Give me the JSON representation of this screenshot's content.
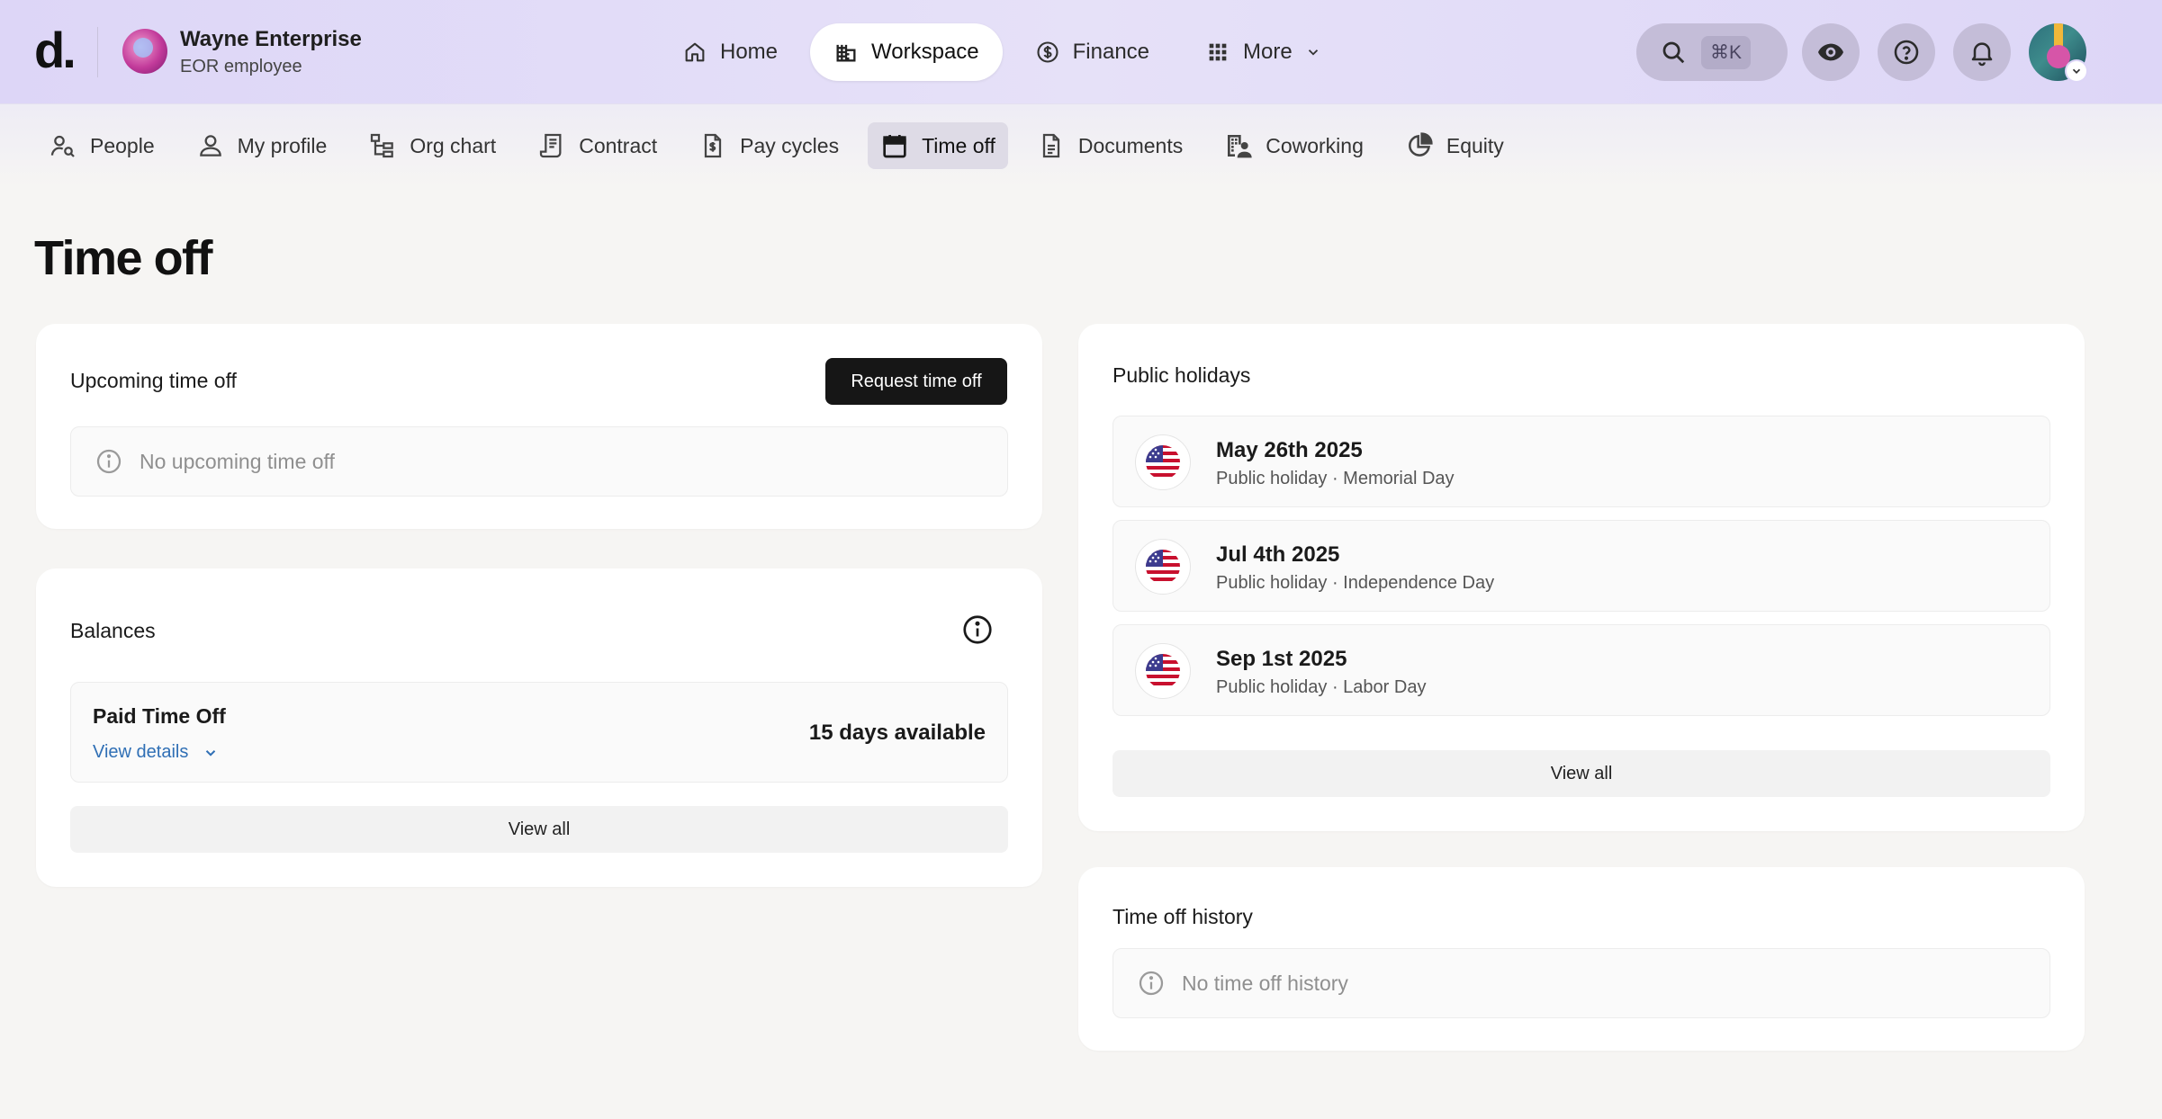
{
  "brand": {
    "logo": "d."
  },
  "org": {
    "name": "Wayne Enterprise",
    "role": "EOR employee"
  },
  "main_nav": [
    {
      "label": "Home",
      "icon": "home-icon"
    },
    {
      "label": "Workspace",
      "icon": "building-icon",
      "active": true
    },
    {
      "label": "Finance",
      "icon": "dollar-circle-icon"
    },
    {
      "label": "More",
      "icon": "grid-icon"
    }
  ],
  "search": {
    "shortcut": "⌘K"
  },
  "sub_nav": [
    {
      "label": "People",
      "icon": "people-search-icon"
    },
    {
      "label": "My profile",
      "icon": "user-icon"
    },
    {
      "label": "Org chart",
      "icon": "org-chart-icon"
    },
    {
      "label": "Contract",
      "icon": "contract-icon"
    },
    {
      "label": "Pay cycles",
      "icon": "pay-document-icon"
    },
    {
      "label": "Time off",
      "icon": "calendar-icon",
      "active": true
    },
    {
      "label": "Documents",
      "icon": "document-icon"
    },
    {
      "label": "Coworking",
      "icon": "coworking-icon"
    },
    {
      "label": "Equity",
      "icon": "pie-chart-icon"
    }
  ],
  "page": {
    "title": "Time off"
  },
  "upcoming": {
    "title": "Upcoming time off",
    "request_button": "Request time off",
    "empty_text": "No upcoming time off"
  },
  "balances": {
    "title": "Balances",
    "items": [
      {
        "name": "Paid Time Off",
        "link": "View details",
        "available": "15 days available"
      }
    ],
    "view_all": "View all"
  },
  "holidays": {
    "title": "Public holidays",
    "items": [
      {
        "date": "May 26th 2025",
        "detail": "Public holiday · Memorial Day"
      },
      {
        "date": "Jul 4th 2025",
        "detail": "Public holiday · Independence Day"
      },
      {
        "date": "Sep 1st 2025",
        "detail": "Public holiday · Labor Day"
      }
    ],
    "view_all": "View all"
  },
  "history": {
    "title": "Time off history",
    "empty_text": "No time off history"
  },
  "colors": {
    "accent_bg": "#ddd6f7",
    "dark_button": "#161616",
    "link": "#2f6fb5"
  }
}
